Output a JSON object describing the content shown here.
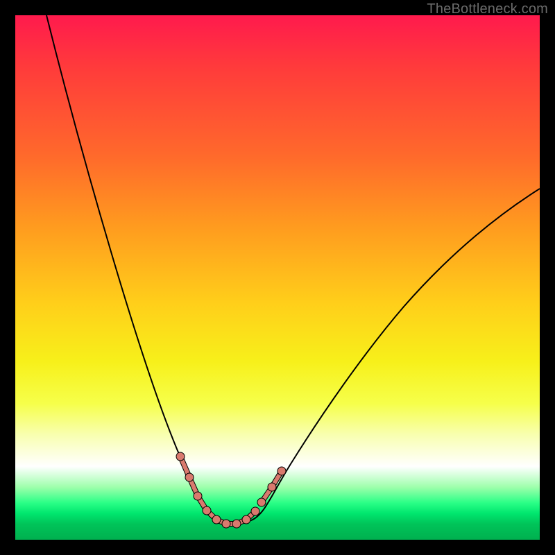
{
  "watermark": "TheBottleneck.com",
  "colors": {
    "frame": "#000000",
    "gradient_stops": [
      "#ff1a4d",
      "#ff3b3b",
      "#ff6a2b",
      "#ff9a1f",
      "#ffcf1a",
      "#f7f01a",
      "#f6ff4a",
      "#f8ffb0",
      "#ffffff",
      "#9dffab",
      "#29ff86",
      "#00e66e",
      "#00c459",
      "#00b04f"
    ],
    "curve": "#000000",
    "trough_marker": "#d97a6e"
  },
  "chart_data": {
    "type": "line",
    "title": "",
    "xlabel": "",
    "ylabel": "",
    "xlim": [
      0,
      1
    ],
    "ylim": [
      0,
      1
    ],
    "note": "No axes or tick labels are shown; values are approximate normalized pixel-space readings of the plotted curve. Lower y is closer to the green zone (bottom).",
    "series": [
      {
        "name": "curve",
        "x": [
          0.06,
          0.1,
          0.14,
          0.18,
          0.22,
          0.26,
          0.3,
          0.33,
          0.36,
          0.4,
          0.44,
          0.48,
          0.52,
          0.56,
          0.6,
          0.66,
          0.74,
          0.82,
          0.9,
          1.0
        ],
        "y": [
          1.0,
          0.88,
          0.76,
          0.64,
          0.52,
          0.4,
          0.28,
          0.18,
          0.1,
          0.03,
          0.03,
          0.05,
          0.11,
          0.2,
          0.29,
          0.4,
          0.5,
          0.58,
          0.63,
          0.67
        ]
      }
    ],
    "annotations": {
      "trough_markers_x": [
        0.31,
        0.33,
        0.35,
        0.37,
        0.39,
        0.41,
        0.43,
        0.45,
        0.47,
        0.475,
        0.49,
        0.51
      ],
      "trough_markers_note": "Salmon dotted/segmented markers around the curve minimum near the bottom green band."
    }
  }
}
